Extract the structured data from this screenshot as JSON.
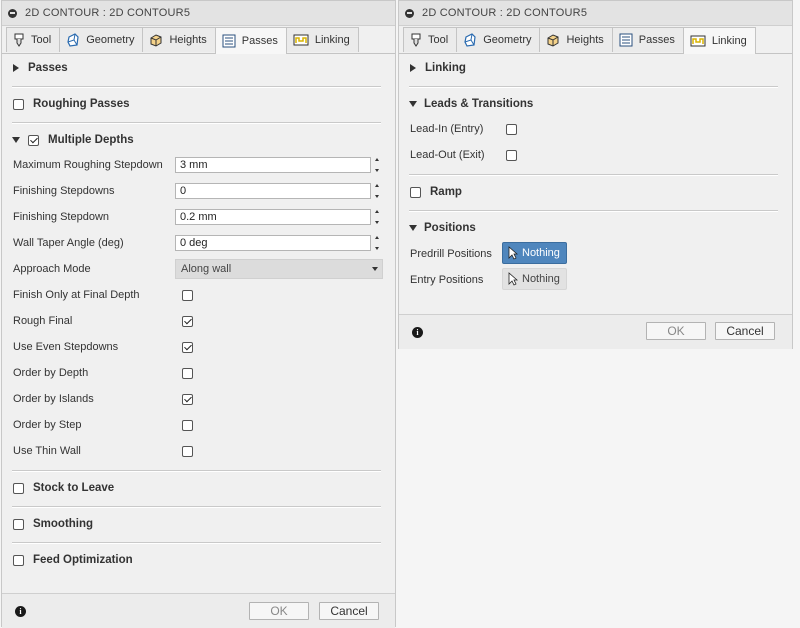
{
  "left_panel": {
    "title": "2D CONTOUR : 2D CONTOUR5",
    "tabs": [
      {
        "label": "Tool",
        "icon": "tool-icon",
        "active": false
      },
      {
        "label": "Geometry",
        "icon": "geometry-icon",
        "active": false
      },
      {
        "label": "Heights",
        "icon": "heights-icon",
        "active": false
      },
      {
        "label": "Passes",
        "icon": "passes-icon",
        "active": true
      },
      {
        "label": "Linking",
        "icon": "linking-icon",
        "active": false
      }
    ],
    "passes_header": "Passes",
    "roughing_passes": {
      "label": "Roughing Passes",
      "checked": false
    },
    "multiple_depths": {
      "label": "Multiple Depths",
      "checked": true,
      "expanded": true
    },
    "fields": {
      "max_roughing_stepdown": {
        "label": "Maximum Roughing Stepdown",
        "value": "3 mm"
      },
      "finishing_stepdowns": {
        "label": "Finishing Stepdowns",
        "value": "0"
      },
      "finishing_stepdown": {
        "label": "Finishing Stepdown",
        "value": "0.2 mm"
      },
      "wall_taper_angle": {
        "label": "Wall Taper Angle (deg)",
        "value": "0 deg"
      },
      "approach_mode": {
        "label": "Approach Mode",
        "value": "Along wall"
      }
    },
    "checkboxes": [
      {
        "label": "Finish Only at Final Depth",
        "checked": false
      },
      {
        "label": "Rough Final",
        "checked": true
      },
      {
        "label": "Use Even Stepdowns",
        "checked": true
      },
      {
        "label": "Order by Depth",
        "checked": false
      },
      {
        "label": "Order by Islands",
        "checked": true
      },
      {
        "label": "Order by Step",
        "checked": false
      },
      {
        "label": "Use Thin Wall",
        "checked": false
      }
    ],
    "stock_to_leave": {
      "label": "Stock to Leave",
      "checked": false
    },
    "smoothing": {
      "label": "Smoothing",
      "checked": false
    },
    "feed_optimization": {
      "label": "Feed Optimization",
      "checked": false
    },
    "ok_label": "OK",
    "cancel_label": "Cancel",
    "info_glyph": "i"
  },
  "right_panel": {
    "title": "2D CONTOUR : 2D CONTOUR5",
    "tabs": [
      {
        "label": "Tool",
        "icon": "tool-icon",
        "active": false
      },
      {
        "label": "Geometry",
        "icon": "geometry-icon",
        "active": false
      },
      {
        "label": "Heights",
        "icon": "heights-icon",
        "active": false
      },
      {
        "label": "Passes",
        "icon": "passes-icon",
        "active": false
      },
      {
        "label": "Linking",
        "icon": "linking-icon",
        "active": true
      }
    ],
    "linking_header": "Linking",
    "leads_transitions": {
      "label": "Leads & Transitions",
      "expanded": true
    },
    "lead_in": {
      "label": "Lead-In (Entry)",
      "checked": false
    },
    "lead_out": {
      "label": "Lead-Out (Exit)",
      "checked": false
    },
    "ramp": {
      "label": "Ramp",
      "checked": false
    },
    "positions": {
      "label": "Positions",
      "expanded": true
    },
    "predrill": {
      "label": "Predrill Positions",
      "button": "Nothing",
      "active": true
    },
    "entry": {
      "label": "Entry Positions",
      "button": "Nothing",
      "active": false
    },
    "ok_label": "OK",
    "cancel_label": "Cancel",
    "info_glyph": "i"
  },
  "colors": {
    "selection_active": "#4f86bd",
    "panel_bg": "#f0f0f0"
  }
}
